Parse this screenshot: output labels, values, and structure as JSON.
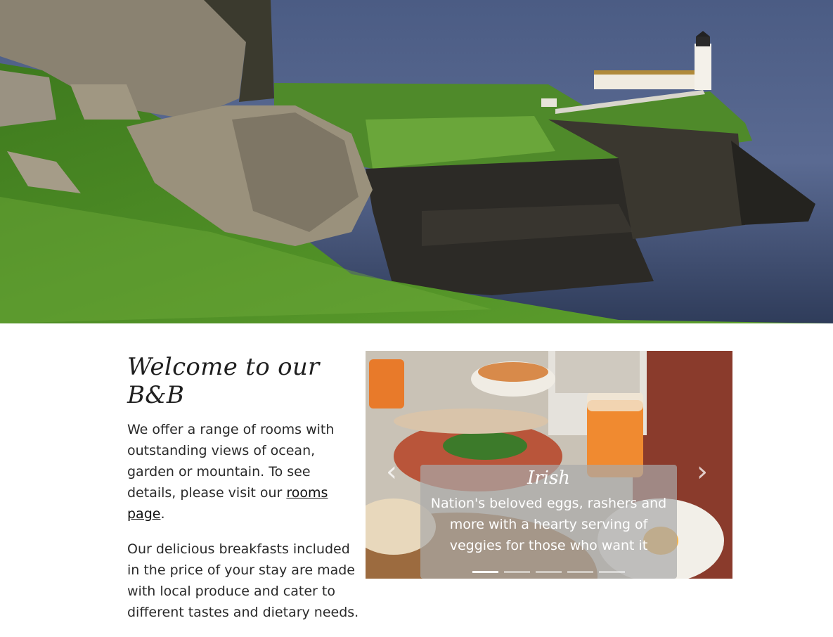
{
  "hero": {
    "image_name": "coastal-lighthouse-cliffs-photo"
  },
  "intro": {
    "title": "Welcome to our B&B",
    "paragraph1_before_link": "We offer a range of rooms with outstanding views of ocean, garden or mountain. To see details, please visit our ",
    "rooms_link_label": "rooms page",
    "paragraph1_after_link": ".",
    "paragraph2": "Our delicious breakfasts included in the price of your stay are made with local produce and cater to different tastes and dietary needs."
  },
  "carousel": {
    "image_name": "breakfast-table-photo",
    "slide_title": "Irish",
    "slide_text": "Nation's beloved eggs, rashers and more with a hearty serving of veggies for those who want it",
    "prev_icon": "chevron-left-icon",
    "next_icon": "chevron-right-icon",
    "indicator_count": 5,
    "active_indicator": 1
  }
}
